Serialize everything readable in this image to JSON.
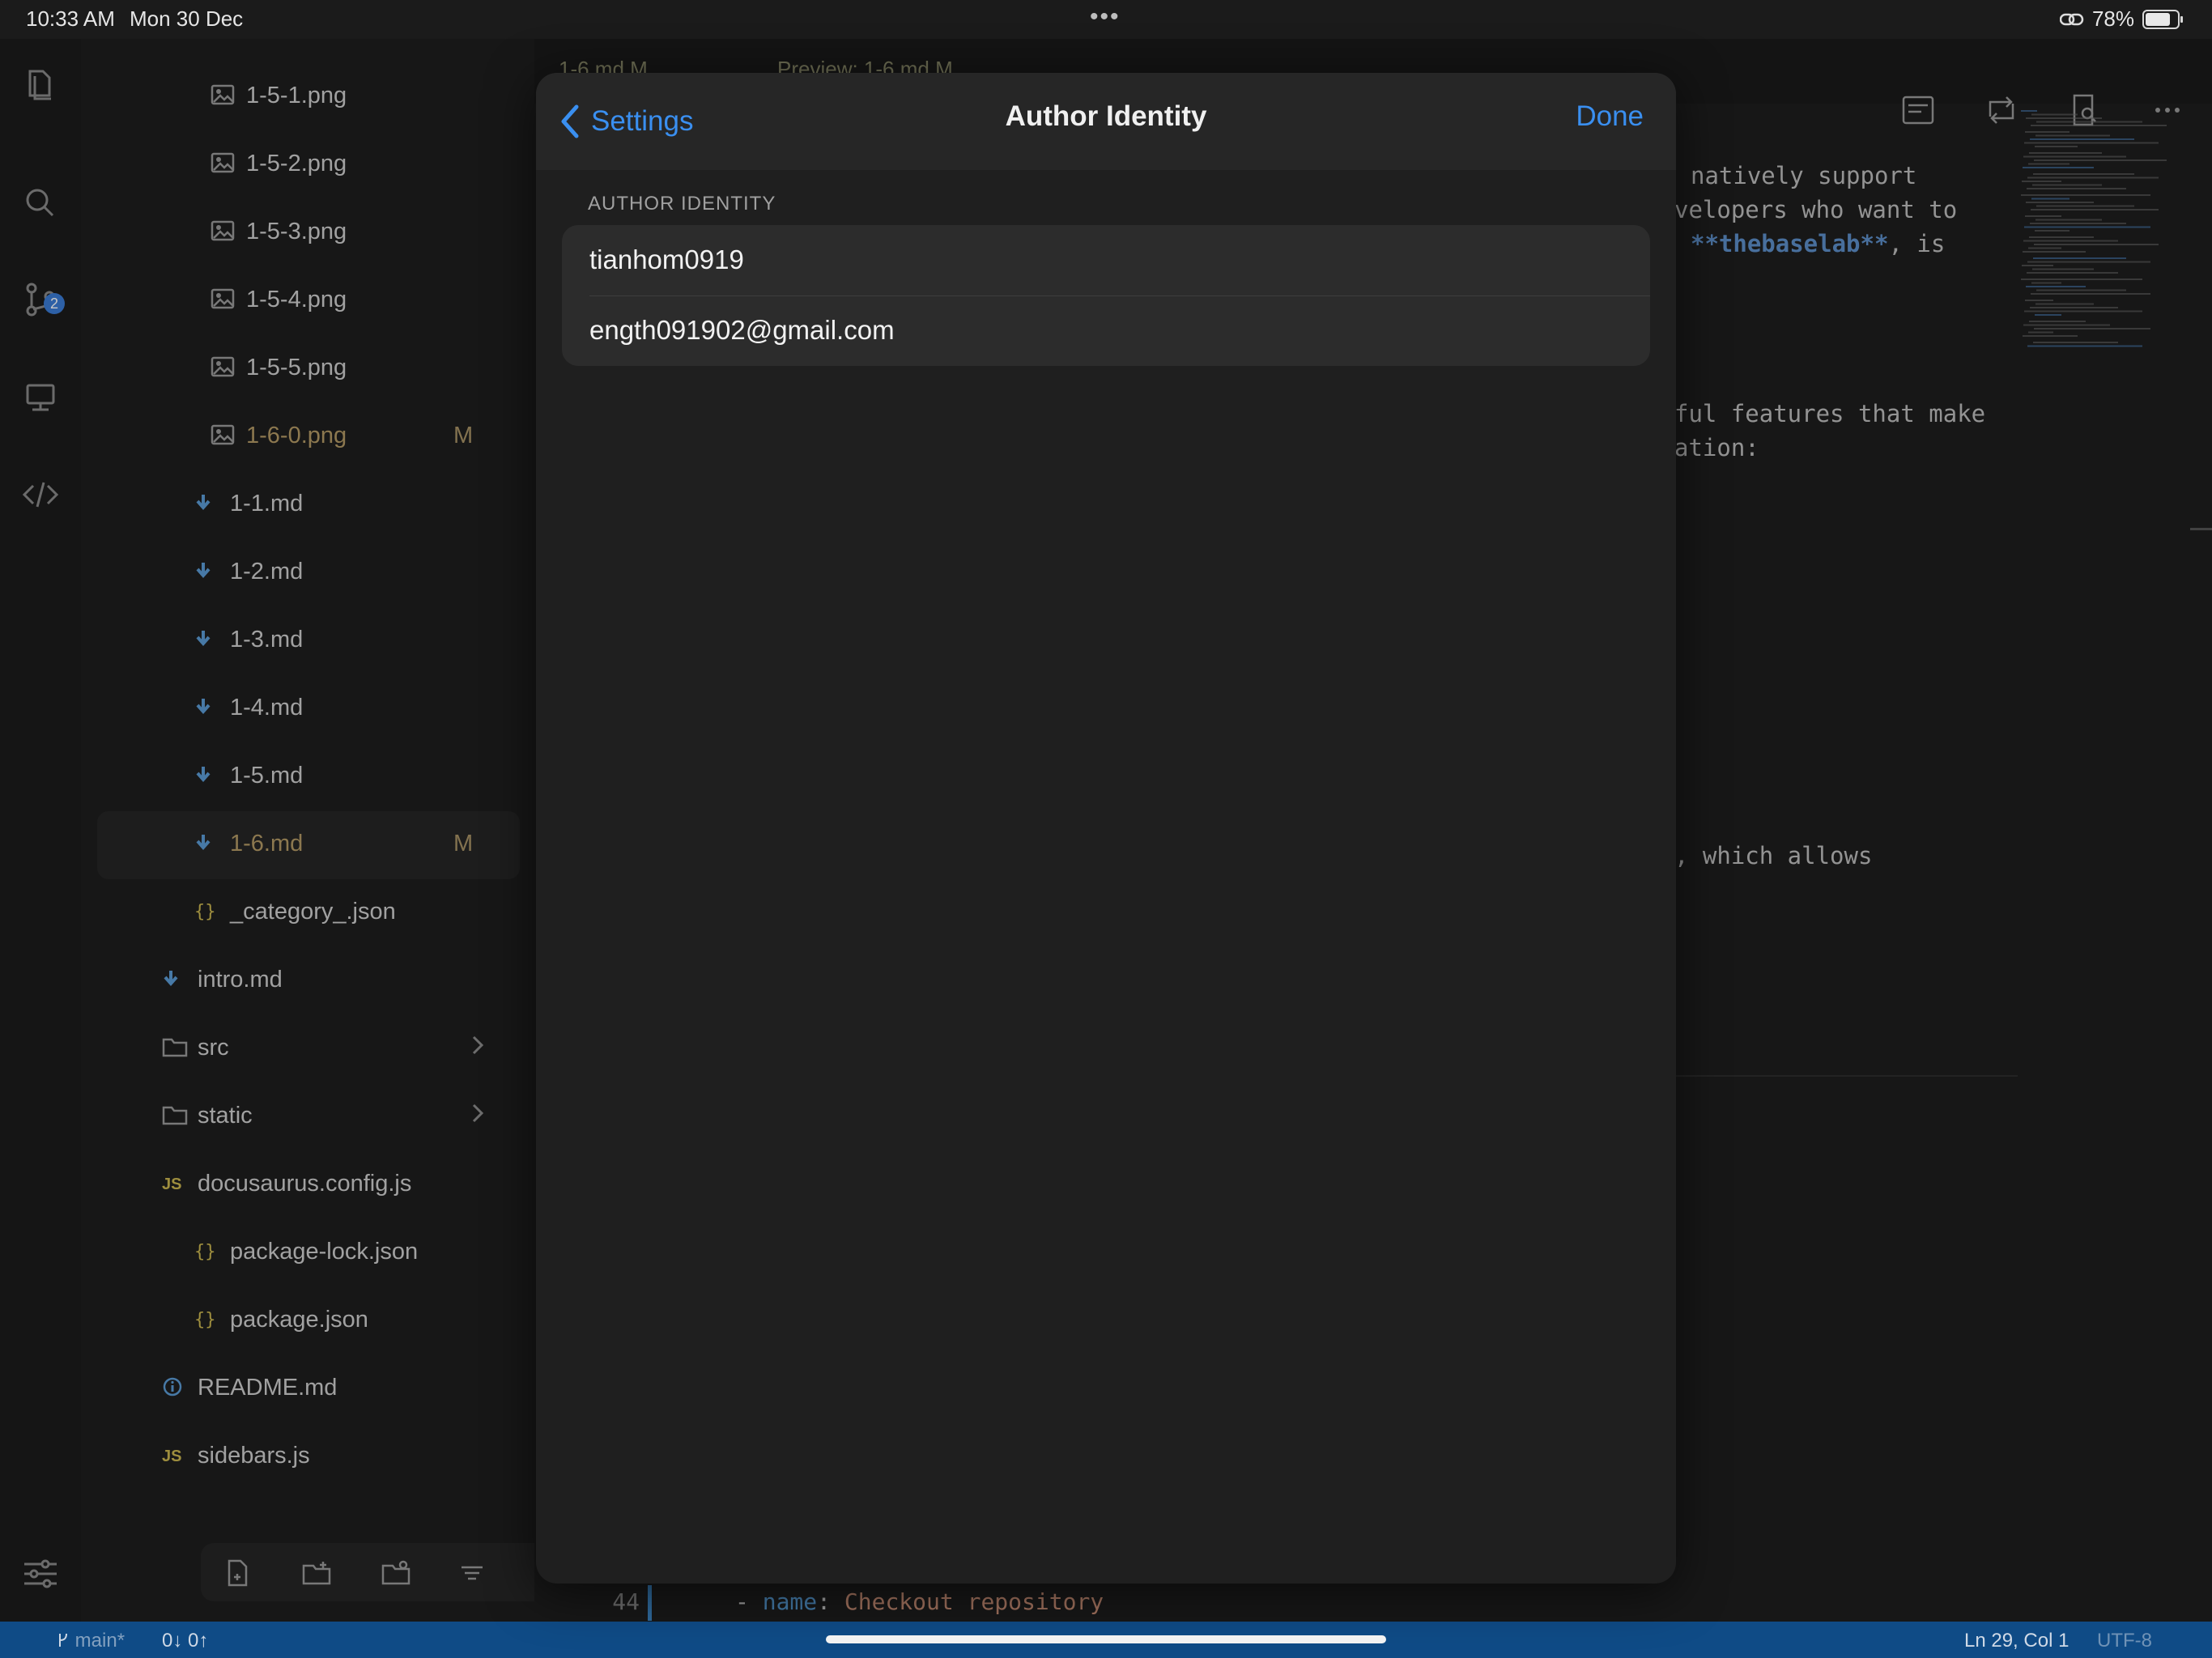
{
  "status_bar": {
    "time": "10:33 AM",
    "date": "Mon 30 Dec",
    "dots": "•••",
    "battery": "78%",
    "battery_level": 0.78
  },
  "activity_bar": {
    "scm_badge": "2"
  },
  "file_tree": [
    {
      "name": "1-5-1.png",
      "type": "image"
    },
    {
      "name": "1-5-2.png",
      "type": "image"
    },
    {
      "name": "1-5-3.png",
      "type": "image"
    },
    {
      "name": "1-5-4.png",
      "type": "image"
    },
    {
      "name": "1-5-5.png",
      "type": "image"
    },
    {
      "name": "1-6-0.png",
      "type": "image",
      "flag": "M"
    },
    {
      "name": "1-1.md",
      "type": "md"
    },
    {
      "name": "1-2.md",
      "type": "md"
    },
    {
      "name": "1-3.md",
      "type": "md"
    },
    {
      "name": "1-4.md",
      "type": "md"
    },
    {
      "name": "1-5.md",
      "type": "md"
    },
    {
      "name": "1-6.md",
      "type": "md",
      "flag": "M",
      "selected": true
    },
    {
      "name": "_category_.json",
      "type": "json"
    },
    {
      "name": "intro.md",
      "type": "md"
    },
    {
      "name": "src",
      "type": "folder"
    },
    {
      "name": "static",
      "type": "folder"
    },
    {
      "name": "docusaurus.config.js",
      "type": "js"
    },
    {
      "name": "package-lock.json",
      "type": "json"
    },
    {
      "name": "package.json",
      "type": "json"
    },
    {
      "name": "README.md",
      "type": "info"
    },
    {
      "name": "sidebars.js",
      "type": "js"
    }
  ],
  "editor": {
    "tabs": [
      "1-6.md M",
      "Preview: 1-6.md M"
    ],
    "code_fragments": {
      "l1": "natively support",
      "l2": "velopers who want to",
      "l3_bold": "**thebaselab**",
      "l3_rest": ", is",
      "l4": "ful features that make",
      "l5": "ation:",
      "l6": ", which allows"
    },
    "line44_number": "44",
    "line44_dash": "- ",
    "line44_key": "name",
    "line44_colon": ": ",
    "line44_value": "Checkout repository"
  },
  "bottom_bar": {
    "branch": "main*",
    "sync": "0↓ 0↑",
    "cursor": "Ln 29, Col 1",
    "encoding": "UTF-8"
  },
  "modal": {
    "back_label": "Settings",
    "title": "Author Identity",
    "done_label": "Done",
    "section_header": "AUTHOR IDENTITY",
    "name_value": "tianhom0919",
    "email_value": "ength091902@gmail.com"
  },
  "colors": {
    "accent": "#3a8ff0",
    "status_bar": "#0f4b86",
    "modified": "#b49a66"
  }
}
